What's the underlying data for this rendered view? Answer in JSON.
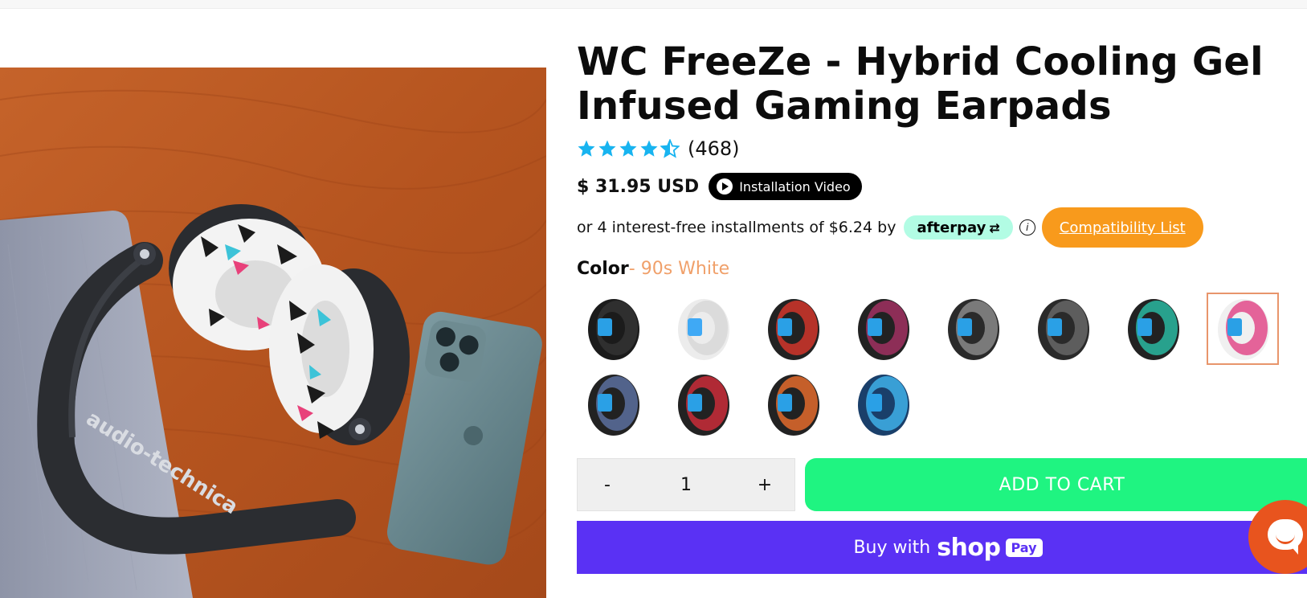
{
  "product": {
    "title": "WC FreeZe - Hybrid Cooling Gel Infused Gaming Earpads",
    "rating_count": "(468)",
    "rating_value": 4.5,
    "price": "$ 31.95 USD",
    "video_button": "Installation Video",
    "installment_text": "or 4 interest-free installments of $6.24 by",
    "afterpay_label": "afterpay",
    "compatibility_label": "Compatibility List",
    "color_label": "Color",
    "color_value": "- 90s White"
  },
  "swatches": [
    {
      "name": "black-blue",
      "outer": "#1b1b1b",
      "inner": "#2aa0e6",
      "accent": "#333333"
    },
    {
      "name": "white",
      "outer": "#ececec",
      "inner": "#3fa9f5",
      "accent": "#d8d8d8"
    },
    {
      "name": "red-camo",
      "outer": "#222222",
      "inner": "#2aa0e6",
      "accent": "#d0352a"
    },
    {
      "name": "purple-red",
      "outer": "#222222",
      "inner": "#2aa0e6",
      "accent": "#a03060"
    },
    {
      "name": "grey-blue",
      "outer": "#2a2a2a",
      "inner": "#2aa0e6",
      "accent": "#888888"
    },
    {
      "name": "dark-grey",
      "outer": "#2a2a2a",
      "inner": "#2aa0e6",
      "accent": "#666666"
    },
    {
      "name": "teal",
      "outer": "#222222",
      "inner": "#2aa0e6",
      "accent": "#29b7a0"
    },
    {
      "name": "90s-white",
      "outer": "#f0f0f0",
      "inner": "#2aa0e6",
      "accent": "#e24a8a"
    },
    {
      "name": "blue-camo",
      "outer": "#222222",
      "inner": "#2aa0e6",
      "accent": "#5a6f9e"
    },
    {
      "name": "red-pattern",
      "outer": "#222222",
      "inner": "#2aa0e6",
      "accent": "#c92b38"
    },
    {
      "name": "orange-pattern",
      "outer": "#222222",
      "inner": "#2aa0e6",
      "accent": "#e26a2c"
    },
    {
      "name": "blue-splash",
      "outer": "#1a3f6a",
      "inner": "#2aa0e6",
      "accent": "#3fb0e8"
    }
  ],
  "selected_swatch": 7,
  "cart": {
    "minus": "-",
    "quantity": "1",
    "plus": "+",
    "add_to_cart": "ADD TO CART",
    "buy_with": "Buy with",
    "shop": "shop",
    "pay": "Pay"
  },
  "colors": {
    "star": "#18b4f0",
    "add_to_cart_bg": "#1ff481",
    "shoppay_bg": "#5a31f4",
    "compat_bg": "#f89a1c",
    "afterpay_bg": "#b2fce4",
    "chat_bg": "#e8541e"
  },
  "image": {
    "brand_text": "audio-technica"
  }
}
